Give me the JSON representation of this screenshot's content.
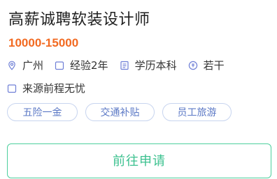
{
  "job": {
    "title": "高薪诚聘软装设计师",
    "salary": "10000-15000"
  },
  "meta": {
    "row1": [
      {
        "icon": "location-pin-icon",
        "text": "广州"
      },
      {
        "icon": "briefcase-icon",
        "text": "经验2年"
      },
      {
        "icon": "document-icon",
        "text": "学历本科"
      },
      {
        "icon": "headcount-icon",
        "text": "若干"
      }
    ],
    "row2": [
      {
        "icon": "source-icon",
        "text": "来源前程无忧"
      }
    ]
  },
  "tags": [
    "五险一金",
    "交通补贴",
    "员工旅游"
  ],
  "actions": {
    "apply_label": "前往申请"
  },
  "colors": {
    "salary": "#f26a21",
    "tag_text": "#5b78c5",
    "tag_border": "#c7d4ef",
    "icon": "#6f7fd6",
    "button_border": "#4ccf9d",
    "button_text": "#3cc18f"
  }
}
